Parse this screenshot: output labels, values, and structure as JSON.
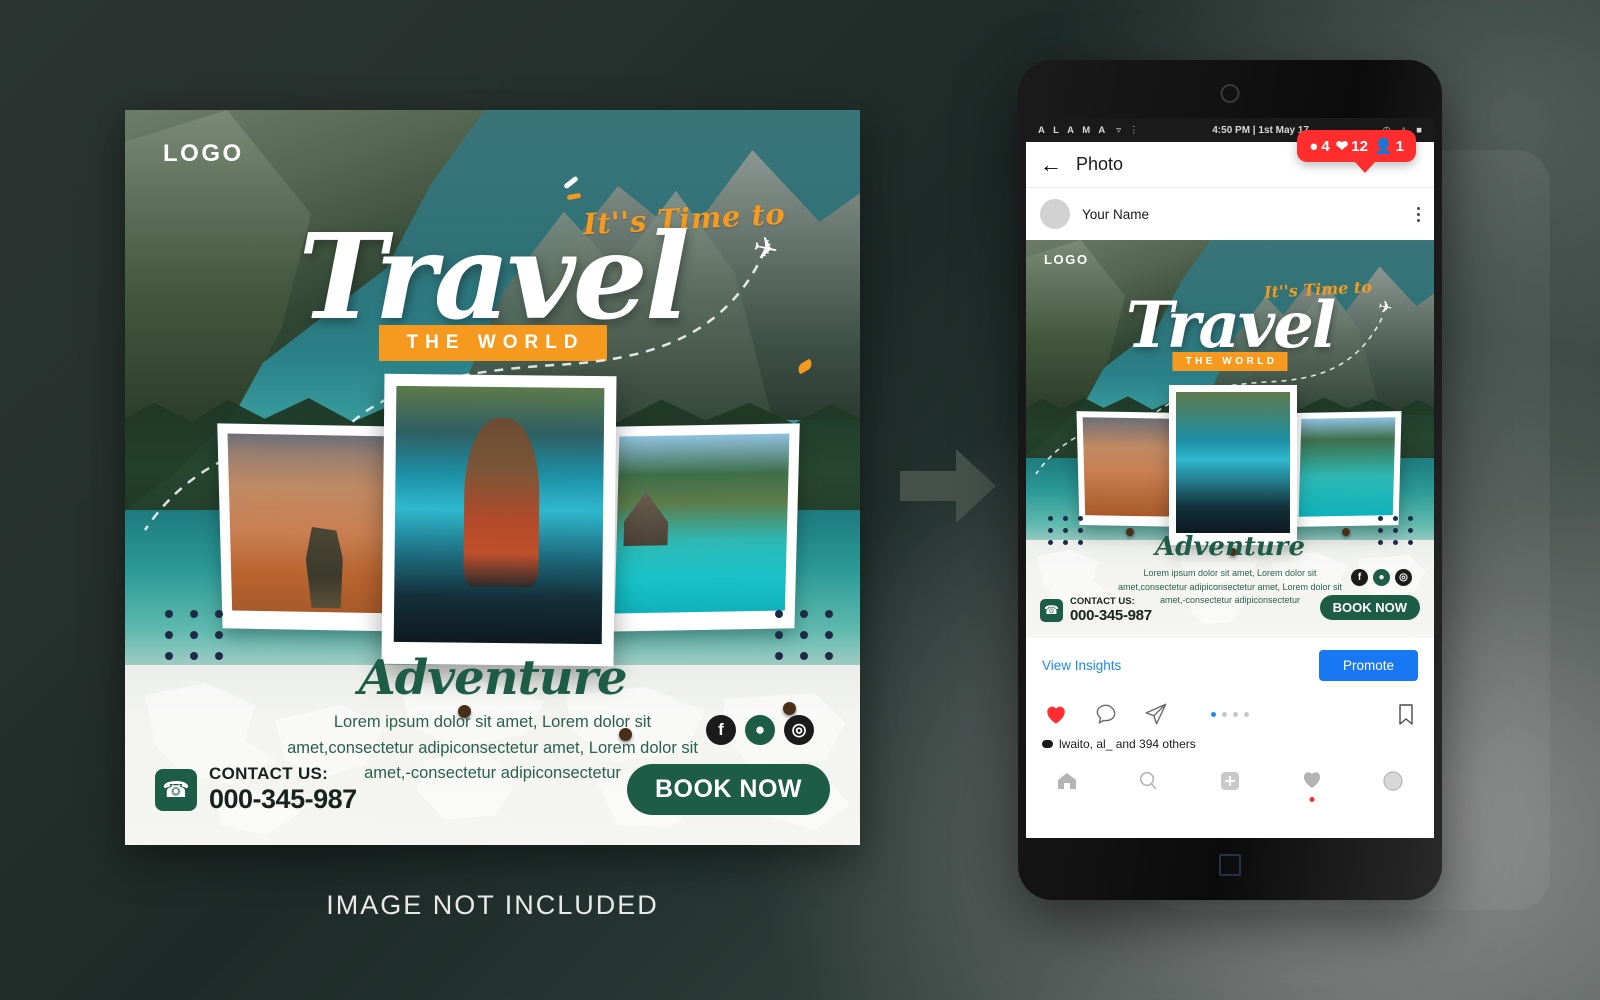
{
  "poster": {
    "logo": "LOGO",
    "kicker": "It''s Time to",
    "headline": "Travel",
    "subhead": "THE WORLD",
    "script_title": "Adventure",
    "body": "Lorem ipsum dolor sit amet, Lorem dolor sit amet,consectetur adipiconsectetur amet, Lorem dolor sit amet,-consectetur adipiconsectetur",
    "contact_label": "CONTACT US:",
    "contact_number": "000-345-987",
    "cta": "BOOK NOW",
    "socials": [
      {
        "name": "facebook-icon",
        "glyph": "f"
      },
      {
        "name": "twitter-icon",
        "glyph": "ᵗ"
      },
      {
        "name": "instagram-icon",
        "glyph": "◎"
      }
    ]
  },
  "arrow": {
    "name": "right-arrow-icon"
  },
  "phone": {
    "status": {
      "carrier": "A L A M A",
      "time": "4:50 PM | 1st May 17",
      "wifi_icon": "wifi-icon",
      "bluetooth_icon": "bluetooth-icon",
      "alarm_icon": "clock-icon",
      "signal_icon": "signal-icon",
      "battery_icon": "battery-icon"
    },
    "appbar": {
      "back_icon": "back-arrow-icon",
      "title": "Photo"
    },
    "user": {
      "name": "Your Name",
      "avatar": "avatar",
      "menu_icon": "kebab-menu-icon"
    },
    "actions": {
      "insights": "View Insights",
      "promote": "Promote",
      "like_icon": "heart-icon",
      "comment_icon": "comment-icon",
      "share_icon": "send-icon",
      "bookmark_icon": "bookmark-icon"
    },
    "badge": {
      "comments": "4",
      "likes": "12",
      "followers": "1"
    },
    "likes_text": "lwaito, al_ and 394 others",
    "tabs": [
      {
        "name": "tab-home",
        "icon": "home-icon"
      },
      {
        "name": "tab-search",
        "icon": "search-icon"
      },
      {
        "name": "tab-add",
        "icon": "plus-icon"
      },
      {
        "name": "tab-activity",
        "icon": "heart-icon"
      },
      {
        "name": "tab-profile",
        "icon": "profile-icon"
      }
    ],
    "home_button": "home-square-icon"
  },
  "caption": "IMAGE NOT INCLUDED",
  "colors": {
    "accent_green": "#1d5c47",
    "accent_orange": "#f59a1f",
    "promote_blue": "#1877f2",
    "badge_red": "#ff2d2d",
    "link_blue": "#1b8af2"
  }
}
